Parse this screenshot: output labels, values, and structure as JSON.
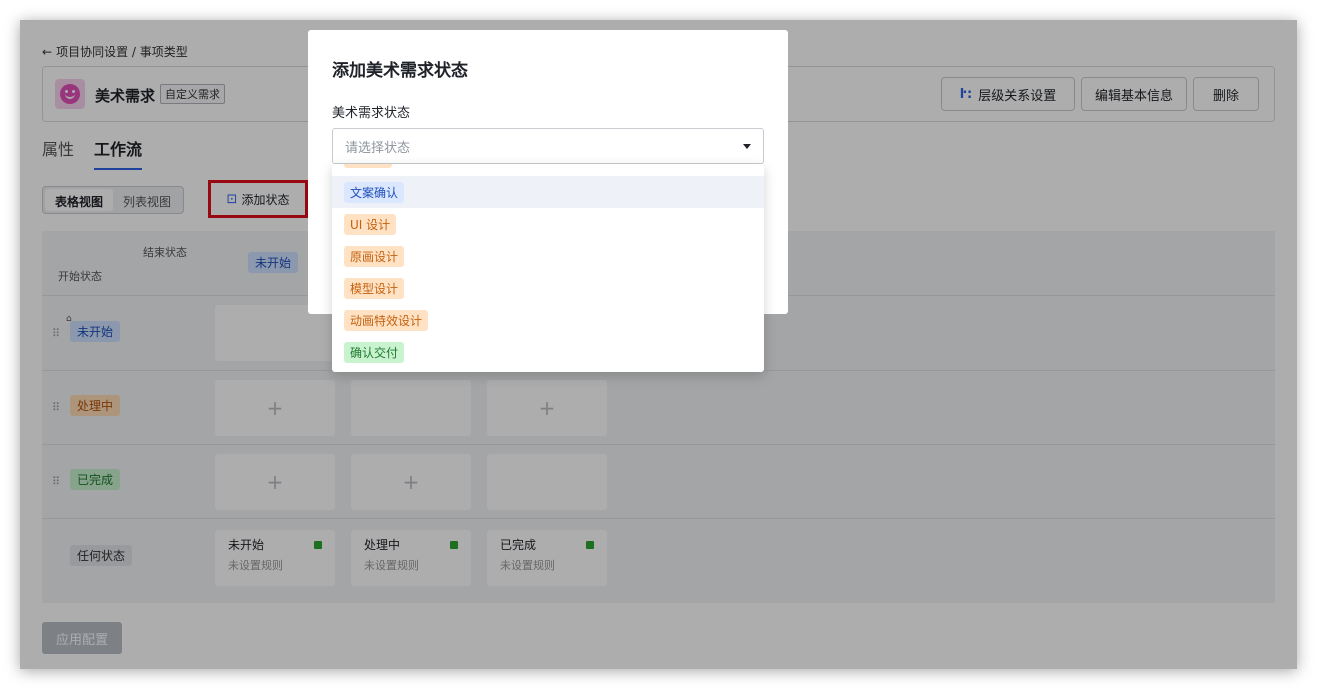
{
  "breadcrumb": {
    "back_icon": "arrow-left-icon",
    "text": "项目协同设置 / 事项类型"
  },
  "header": {
    "title": "美术需求",
    "tag": "自定义需求",
    "hierarchy_label": "层级关系设置",
    "edit_label": "编辑基本信息",
    "delete_label": "删除"
  },
  "tabs": [
    {
      "label": "属性"
    },
    {
      "label": "工作流"
    }
  ],
  "view_switch": {
    "table": "表格视图",
    "list": "列表视图"
  },
  "add_state_label": "添加状态",
  "grid": {
    "corner_end": "结束状态",
    "corner_start": "开始状态",
    "col_header_visible": "未开始",
    "rows": [
      {
        "label": "未开始",
        "color": "blue"
      },
      {
        "label": "处理中",
        "color": "orange"
      },
      {
        "label": "已完成",
        "color": "green"
      },
      {
        "label": "任何状态",
        "color": "gray"
      }
    ],
    "plus": "+",
    "rules": [
      {
        "title": "未开始",
        "sub": "未设置规则"
      },
      {
        "title": "处理中",
        "sub": "未设置规则"
      },
      {
        "title": "已完成",
        "sub": "未设置规则"
      }
    ]
  },
  "apply_label": "应用配置",
  "modal": {
    "title": "添加美术需求状态",
    "field_label": "美术需求状态",
    "placeholder": "请选择状态"
  },
  "dropdown": {
    "options": [
      {
        "label": "文案确认",
        "color": "blue"
      },
      {
        "label": "UI 设计",
        "color": "orange"
      },
      {
        "label": "原画设计",
        "color": "orange"
      },
      {
        "label": "模型设计",
        "color": "orange"
      },
      {
        "label": "动画特效设计",
        "color": "orange"
      },
      {
        "label": "确认交付",
        "color": "green"
      }
    ]
  },
  "colors": {
    "accent": "#2d64e8",
    "highlight_border": "#e00d1a",
    "rule_dot": "#2ba52e"
  }
}
